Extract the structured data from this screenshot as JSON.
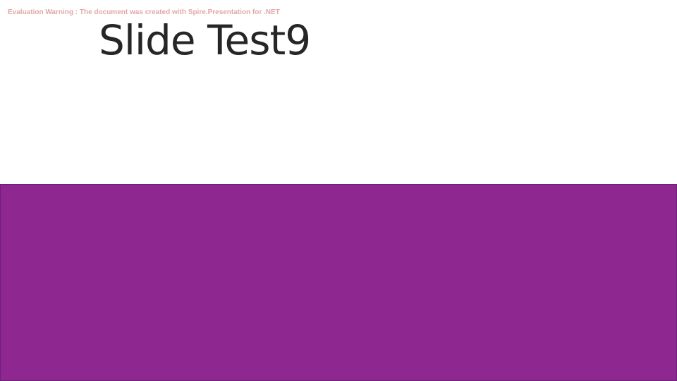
{
  "slide": {
    "evaluation_warning": "Evaluation Warning : The document was created with  Spire.Presentation for .NET",
    "title": "Slide Test9",
    "band_color": "#8e278f",
    "background_color": "#ffffff"
  }
}
